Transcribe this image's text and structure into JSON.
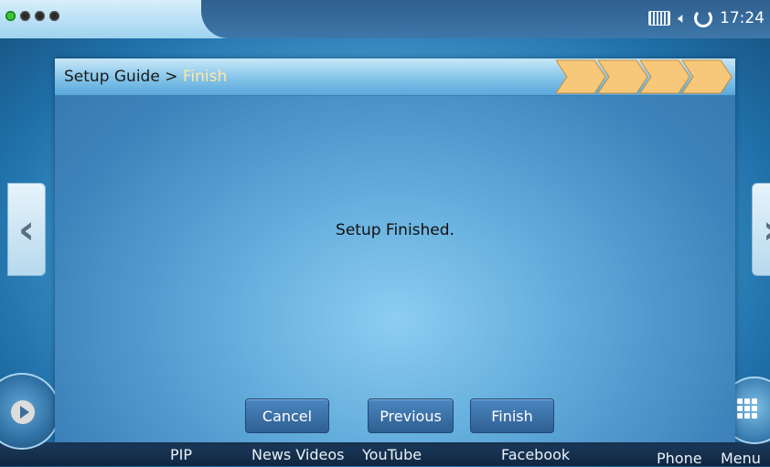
{
  "status_bar": {
    "time": "17:24",
    "indicator_dots": [
      "green",
      "dark",
      "dark",
      "dark"
    ]
  },
  "dialog": {
    "breadcrumb_parent": "Setup Guide >",
    "breadcrumb_current": "Finish",
    "message": "Setup Finished.",
    "step_count": 4,
    "buttons": {
      "cancel": "Cancel",
      "previous": "Previous",
      "finish": "Finish"
    }
  },
  "bottom_bar": {
    "items": [
      "PIP",
      "News Videos",
      "YouTube",
      "Facebook",
      "Phone",
      "Menu"
    ]
  },
  "colors": {
    "accent_orange": "#f7c77a",
    "button_blue": "#3b6fa6",
    "current_step_text": "#ffe6a6"
  }
}
